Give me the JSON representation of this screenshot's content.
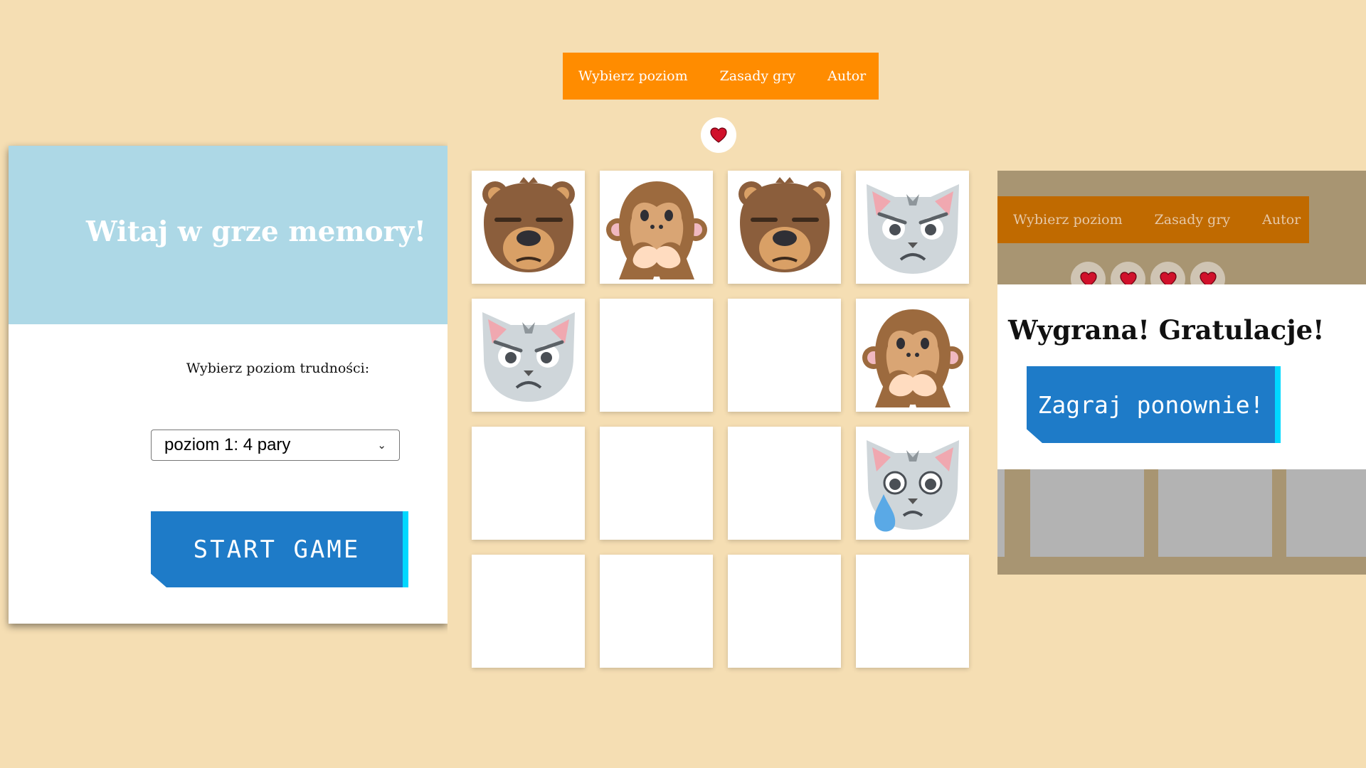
{
  "start_screen": {
    "title": "Witaj w grze memory!",
    "level_label": "Wybierz poziom trudności:",
    "level_select": {
      "value": "poziom 1: 4 pary"
    },
    "start_button": "START GAME"
  },
  "nav": {
    "items": [
      "Wybierz poziom",
      "Zasady gry",
      "Autor"
    ]
  },
  "game": {
    "lives": 1,
    "cards": [
      {
        "face": "bear-icon"
      },
      {
        "face": "monkey-icon"
      },
      {
        "face": "bear-icon"
      },
      {
        "face": "angry-cat-icon"
      },
      {
        "face": "angry-cat-icon"
      },
      {
        "face": "hidden"
      },
      {
        "face": "hidden"
      },
      {
        "face": "monkey-icon"
      },
      {
        "face": "hidden"
      },
      {
        "face": "hidden"
      },
      {
        "face": "hidden"
      },
      {
        "face": "crying-cat-icon"
      },
      {
        "face": "hidden"
      },
      {
        "face": "hidden"
      },
      {
        "face": "hidden"
      },
      {
        "face": "hidden"
      }
    ]
  },
  "win_screen": {
    "lives": 4,
    "title": "Wygrana! Gratulacje!",
    "replay_button": "Zagraj ponownie!"
  },
  "colors": {
    "background": "#f5deb3",
    "nav": "#ff8c00",
    "header": "#add8e6",
    "button": "#1e7bc8",
    "button_accent": "#00d8ff"
  }
}
